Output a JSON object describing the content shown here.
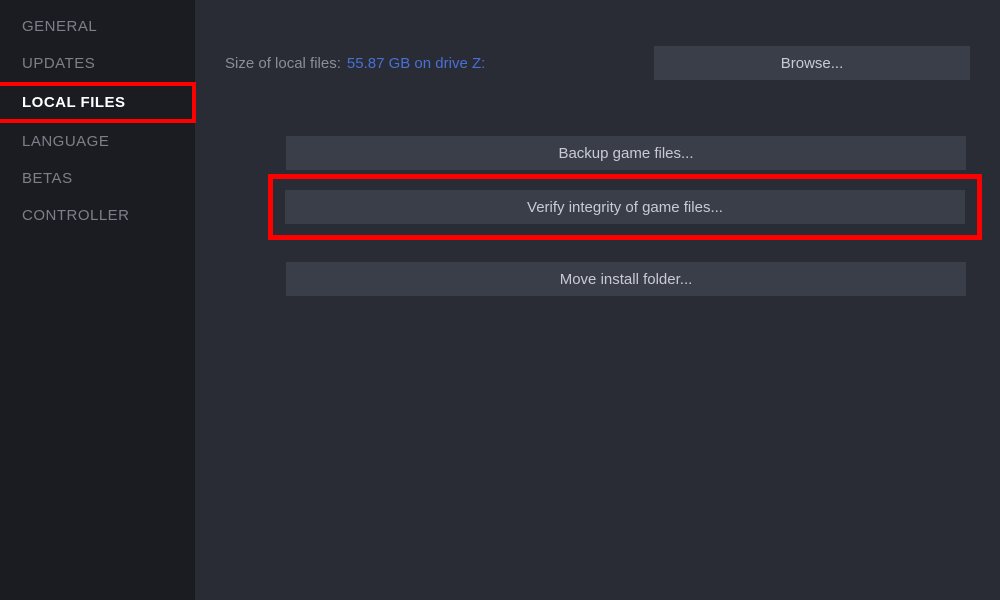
{
  "sidebar": {
    "items": [
      {
        "label": "GENERAL"
      },
      {
        "label": "UPDATES"
      },
      {
        "label": "LOCAL FILES"
      },
      {
        "label": "LANGUAGE"
      },
      {
        "label": "BETAS"
      },
      {
        "label": "CONTROLLER"
      }
    ]
  },
  "content": {
    "size_label": "Size of local files:",
    "size_value": "55.87 GB on drive Z:",
    "browse_label": "Browse...",
    "backup_label": "Backup game files...",
    "verify_label": "Verify integrity of game files...",
    "move_label": "Move install folder..."
  }
}
